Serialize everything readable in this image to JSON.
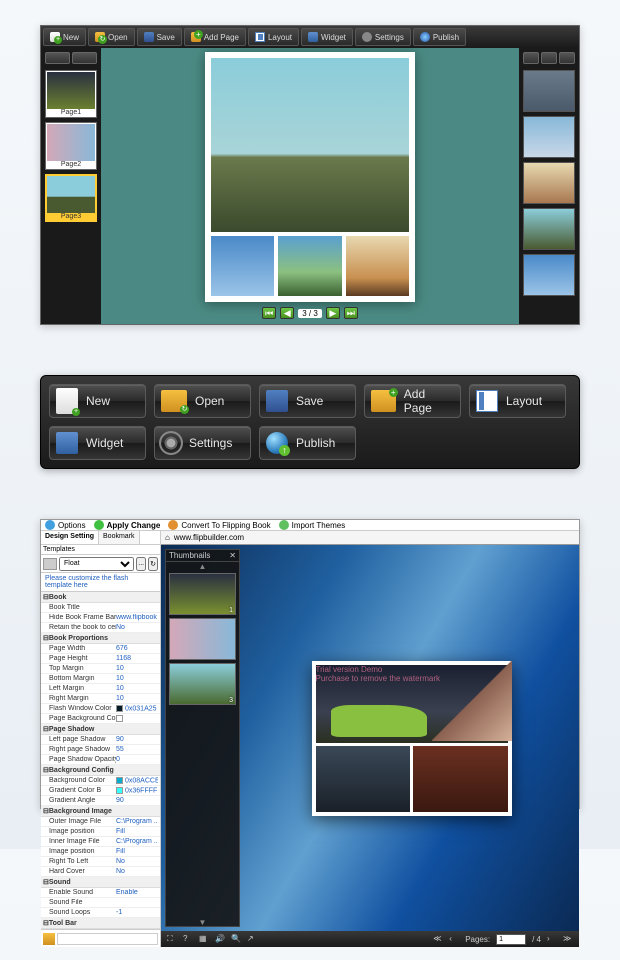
{
  "editor": {
    "toolbar": [
      {
        "id": "new",
        "label": "New"
      },
      {
        "id": "open",
        "label": "Open"
      },
      {
        "id": "save",
        "label": "Save"
      },
      {
        "id": "addpage",
        "label": "Add Page"
      },
      {
        "id": "layout",
        "label": "Layout"
      },
      {
        "id": "widget",
        "label": "Widget"
      },
      {
        "id": "settings",
        "label": "Settings"
      },
      {
        "id": "publish",
        "label": "Publish"
      }
    ],
    "pages": [
      {
        "label": "Page1"
      },
      {
        "label": "Page2"
      },
      {
        "label": "Page3"
      }
    ],
    "nav": {
      "current": "3",
      "total": "3"
    }
  },
  "bigToolbar": [
    {
      "id": "new",
      "label": "New",
      "icon": "ic-new"
    },
    {
      "id": "open",
      "label": "Open",
      "icon": "ic-open"
    },
    {
      "id": "save",
      "label": "Save",
      "icon": "ic-save"
    },
    {
      "id": "addpage",
      "label": "Add Page",
      "icon": "ic-add"
    },
    {
      "id": "layout",
      "label": "Layout",
      "icon": "ic-layout"
    },
    {
      "id": "widget",
      "label": "Widget",
      "icon": "ic-widget"
    },
    {
      "id": "settings",
      "label": "Settings",
      "icon": "ic-settings"
    },
    {
      "id": "publish",
      "label": "Publish",
      "icon": "ic-publish"
    }
  ],
  "tpl": {
    "toolbar": {
      "options": "Options",
      "apply": "Apply Change",
      "convert": "Convert To Flipping Book",
      "import": "Import Themes"
    },
    "tabs": {
      "design": "Design Setting",
      "bookmark": "Bookmark"
    },
    "templateLabel": "Templates",
    "templateValue": "Float",
    "note": "Please customize the flash template here",
    "groups": [
      {
        "name": "Book",
        "rows": [
          {
            "k": "Book Title",
            "v": ""
          },
          {
            "k": "Hide Book Frame Bar",
            "v": "www.flipbook"
          },
          {
            "k": "Retain the book to center",
            "v": "No"
          }
        ]
      },
      {
        "name": "Book Proportions",
        "rows": [
          {
            "k": "Page Width",
            "v": "676"
          },
          {
            "k": "Page Height",
            "v": "1168"
          },
          {
            "k": "Top Margin",
            "v": "10"
          },
          {
            "k": "Bottom Margin",
            "v": "10"
          },
          {
            "k": "Left Margin",
            "v": "10"
          },
          {
            "k": "Right Margin",
            "v": "10"
          },
          {
            "k": "Flash Window Color",
            "v": "0x031A25",
            "sw": "#031A25"
          },
          {
            "k": "Page Background Color",
            "v": "",
            "sw": "#ffffff"
          }
        ]
      },
      {
        "name": "Page Shadow",
        "rows": [
          {
            "k": "Left page Shadow",
            "v": "90"
          },
          {
            "k": "Right page Shadow",
            "v": "55"
          },
          {
            "k": "Page Shadow Opacity",
            "v": "0"
          }
        ]
      },
      {
        "name": "Background Config",
        "rows": [
          {
            "k": "Background Color",
            "v": "0x08ACCE",
            "sw": "#08ACCE"
          },
          {
            "k": "Gradient Color B",
            "v": "0x36FFFF",
            "sw": "#36FFFF"
          },
          {
            "k": "Gradient Angle",
            "v": "90"
          }
        ]
      },
      {
        "name": "Background Image",
        "rows": [
          {
            "k": "Outer Image File",
            "v": "C:\\Program ..."
          },
          {
            "k": "Image position",
            "v": "Fill"
          },
          {
            "k": "Inner Image File",
            "v": "C:\\Program ..."
          },
          {
            "k": "Image position",
            "v": "Fill"
          }
        ]
      },
      {
        "name": "",
        "rows": [
          {
            "k": "Right To Left",
            "v": "No"
          },
          {
            "k": "Hard Cover",
            "v": "No"
          }
        ]
      },
      {
        "name": "Sound",
        "rows": [
          {
            "k": "Enable Sound",
            "v": "Enable"
          },
          {
            "k": "Sound File",
            "v": ""
          },
          {
            "k": "Sound Loops",
            "v": "-1"
          }
        ]
      },
      {
        "name": "Tool Bar",
        "rows": []
      }
    ],
    "thumbHeader": "Thumbnails",
    "thumbs": [
      "1",
      "3"
    ],
    "url": "www.flipbuilder.com",
    "watermark": {
      "l1": "Trial version Demo",
      "l2": "Purchase to remove the watermark"
    },
    "footer": {
      "pagesLabel": "Pages:",
      "pageValue": "1",
      "pageTotal": "/ 4"
    }
  }
}
